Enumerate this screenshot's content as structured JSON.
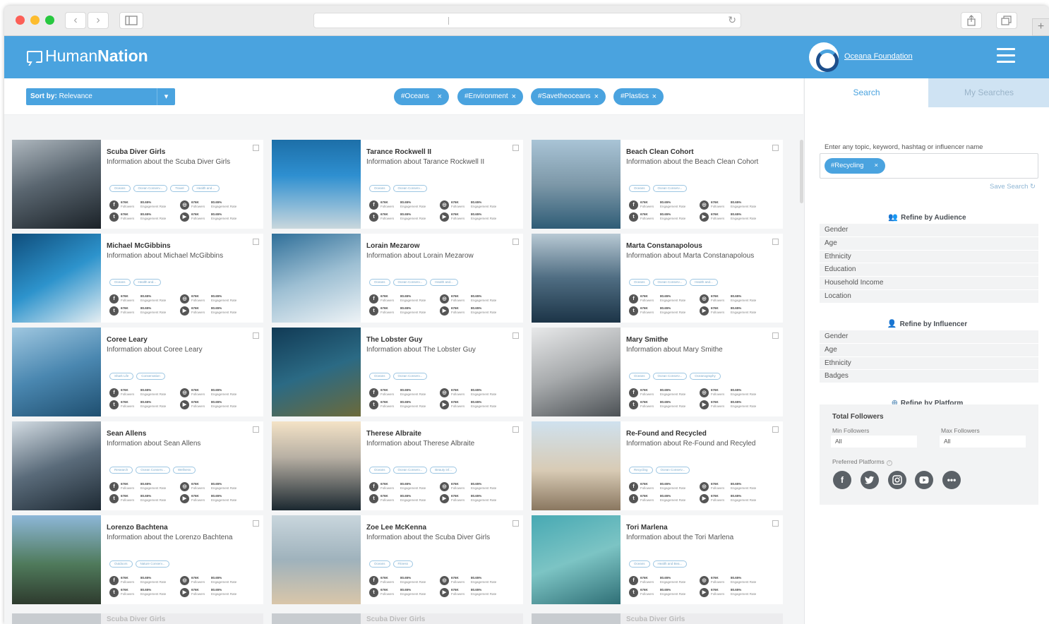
{
  "browser": {
    "back": "‹",
    "forward": "›",
    "new_tab": "+"
  },
  "app": {
    "logo_light": "Human",
    "logo_bold": "Nation",
    "org_name": "Oceana Foundation"
  },
  "toolbar": {
    "sort_label": "Sort by:",
    "sort_value": "Relevance",
    "chips": [
      {
        "label": "#Oceans"
      },
      {
        "label": "#Environment"
      },
      {
        "label": "#Savetheoceans"
      },
      {
        "label": "#Plastics"
      }
    ],
    "remove_symbol": "×"
  },
  "stat_labels": {
    "followers": "Followers",
    "engagement": "Engagement Rate"
  },
  "cards": [
    {
      "name": "Scuba Diver Girls",
      "desc": "Information about the Scuba Diver Girls",
      "tags": [
        "Oceans",
        "Ocean Conserv...",
        "Travel",
        "Health and..."
      ],
      "stats": [
        [
          "676K",
          "80.65%"
        ],
        [
          "676K",
          "80.65%"
        ],
        [
          "676K",
          "80.65%"
        ],
        [
          "676K",
          "80.65%"
        ]
      ]
    },
    {
      "name": "Tarance Rockwell II",
      "desc": "Information about Tarance Rockwell II",
      "tags": [
        "Oceans",
        "Ocean Conserv..."
      ],
      "stats": [
        [
          "676K",
          "80.65%"
        ],
        [
          "676K",
          "80.65%"
        ],
        [
          "676K",
          "80.65%"
        ],
        [
          "676K",
          "80.65%"
        ]
      ]
    },
    {
      "name": "Beach Clean Cohort",
      "desc": "Information about the Beach Clean Cohort",
      "tags": [
        "Oceans",
        "Ocean Conserv..."
      ],
      "stats": [
        [
          "676K",
          "80.65%"
        ],
        [
          "676K",
          "80.65%"
        ],
        [
          "676K",
          "80.65%"
        ],
        [
          "676K",
          "80.65%"
        ]
      ]
    },
    {
      "name": "Michael McGibbins",
      "desc": "Information about Michael McGibbins",
      "tags": [
        "Oceans",
        "Health and..."
      ],
      "stats": [
        [
          "676K",
          "80.65%"
        ],
        [
          "676K",
          "80.65%"
        ],
        [
          "676K",
          "80.65%"
        ],
        [
          "676K",
          "80.65%"
        ]
      ]
    },
    {
      "name": "Lorain Mezarow",
      "desc": "Information about Lorain Mezarow",
      "tags": [
        "Oceans",
        "Ocean Conserv...",
        "Health and..."
      ],
      "stats": [
        [
          "676K",
          "80.65%"
        ],
        [
          "676K",
          "80.65%"
        ],
        [
          "676K",
          "80.65%"
        ],
        [
          "676K",
          "80.65%"
        ]
      ]
    },
    {
      "name": "Marta Constanapolous",
      "desc": "Information about Marta Constanapolous",
      "tags": [
        "Oceans",
        "Ocean Conserv...",
        "Health and..."
      ],
      "stats": [
        [
          "676K",
          "80.65%"
        ],
        [
          "676K",
          "80.65%"
        ],
        [
          "676K",
          "80.65%"
        ],
        [
          "676K",
          "80.65%"
        ]
      ]
    },
    {
      "name": "Coree Leary",
      "desc": "Information about Coree Leary",
      "tags": [
        "Shark Life",
        "Conservation"
      ],
      "stats": [
        [
          "676K",
          "80.65%"
        ],
        [
          "676K",
          "80.65%"
        ],
        [
          "676K",
          "80.65%"
        ],
        [
          "676K",
          "80.65%"
        ]
      ]
    },
    {
      "name": "The Lobster Guy",
      "desc": "Information about The Lobster Guy",
      "tags": [
        "Oceans",
        "Ocean Conserv..."
      ],
      "stats": [
        [
          "676K",
          "80.65%"
        ],
        [
          "676K",
          "80.65%"
        ],
        [
          "676K",
          "80.65%"
        ],
        [
          "676K",
          "80.65%"
        ]
      ]
    },
    {
      "name": "Mary Smithe",
      "desc": "Information about Mary Smithe",
      "tags": [
        "Oceans",
        "Ocean Conserv...",
        "Oceanography"
      ],
      "stats": [
        [
          "676K",
          "80.65%"
        ],
        [
          "676K",
          "80.65%"
        ],
        [
          "676K",
          "80.65%"
        ],
        [
          "676K",
          "80.65%"
        ]
      ]
    },
    {
      "name": "Sean Allens",
      "desc": "Information about Sean Allens",
      "tags": [
        "Research",
        "Ocean Conserv...",
        "Wellness"
      ],
      "stats": [
        [
          "676K",
          "80.65%"
        ],
        [
          "676K",
          "80.65%"
        ],
        [
          "676K",
          "80.65%"
        ],
        [
          "676K",
          "80.65%"
        ]
      ]
    },
    {
      "name": "Therese Albraite",
      "desc": "Information about Therese Albraite",
      "tags": [
        "Oceans",
        "Ocean Conserv...",
        "Beauty inf..."
      ],
      "stats": [
        [
          "676K",
          "80.65%"
        ],
        [
          "676K",
          "80.65%"
        ],
        [
          "676K",
          "80.65%"
        ],
        [
          "676K",
          "80.65%"
        ]
      ]
    },
    {
      "name": "Re-Found and Recycled",
      "desc": "Information about Re-Found and Recyled",
      "tags": [
        "Recycling",
        "Ocean Conserv..."
      ],
      "stats": [
        [
          "676K",
          "80.65%"
        ],
        [
          "676K",
          "80.65%"
        ],
        [
          "676K",
          "80.65%"
        ],
        [
          "676K",
          "80.65%"
        ]
      ]
    },
    {
      "name": "Lorenzo Bachtena",
      "desc": "Information about the Lorenzo Bachtena",
      "tags": [
        "Outdoors",
        "Nature Conserv..."
      ],
      "stats": [
        [
          "676K",
          "80.65%"
        ],
        [
          "676K",
          "80.65%"
        ],
        [
          "676K",
          "80.65%"
        ],
        [
          "676K",
          "80.65%"
        ]
      ]
    },
    {
      "name": "Zoe Lee McKenna",
      "desc": "Information about the Scuba Diver Girls",
      "tags": [
        "Oceans",
        "Fitness"
      ],
      "stats": [
        [
          "676K",
          "80.65%"
        ],
        [
          "676K",
          "80.65%"
        ],
        [
          "676K",
          "80.65%"
        ],
        [
          "676K",
          "80.65%"
        ]
      ]
    },
    {
      "name": "Tori Marlena",
      "desc": "Information about the Tori Marlena",
      "tags": [
        "Oceans",
        "Health and Bea..."
      ],
      "stats": [
        [
          "676K",
          "80.65%"
        ],
        [
          "676K",
          "80.65%"
        ],
        [
          "676K",
          "80.65%"
        ],
        [
          "676K",
          "80.65%"
        ]
      ]
    }
  ],
  "peek_cards": [
    "Scuba Diver Girls",
    "Scuba Diver Girls",
    "Scuba Diver Girls"
  ],
  "sidebar": {
    "tabs": {
      "search": "Search",
      "my_searches": "My Searches"
    },
    "prompt": "Enter any topic, keyword, hashtag or influencer name",
    "search_chip": "#Recycling",
    "save_search": "Save Search",
    "audience_title": "Refine by Audience",
    "audience_filters": [
      "Gender",
      "Age",
      "Ethnicity",
      "Education",
      "Household Income",
      "Location"
    ],
    "influencer_title": "Refine by Influencer",
    "influencer_filters": [
      "Gender",
      "Age",
      "Ethnicity",
      "Badges"
    ],
    "platform_title": "Refine by Platform",
    "total_followers": "Total Followers",
    "min_label": "Min Followers",
    "max_label": "Max Followers",
    "min_value": "All",
    "max_value": "All",
    "preferred_platforms": "Preferred Platforms",
    "platforms": [
      "facebook-icon",
      "twitter-icon",
      "instagram-icon",
      "youtube-icon",
      "more-icon"
    ]
  },
  "colors": {
    "accent": "#4aa3df",
    "page_bg": "#f4f5f6"
  }
}
